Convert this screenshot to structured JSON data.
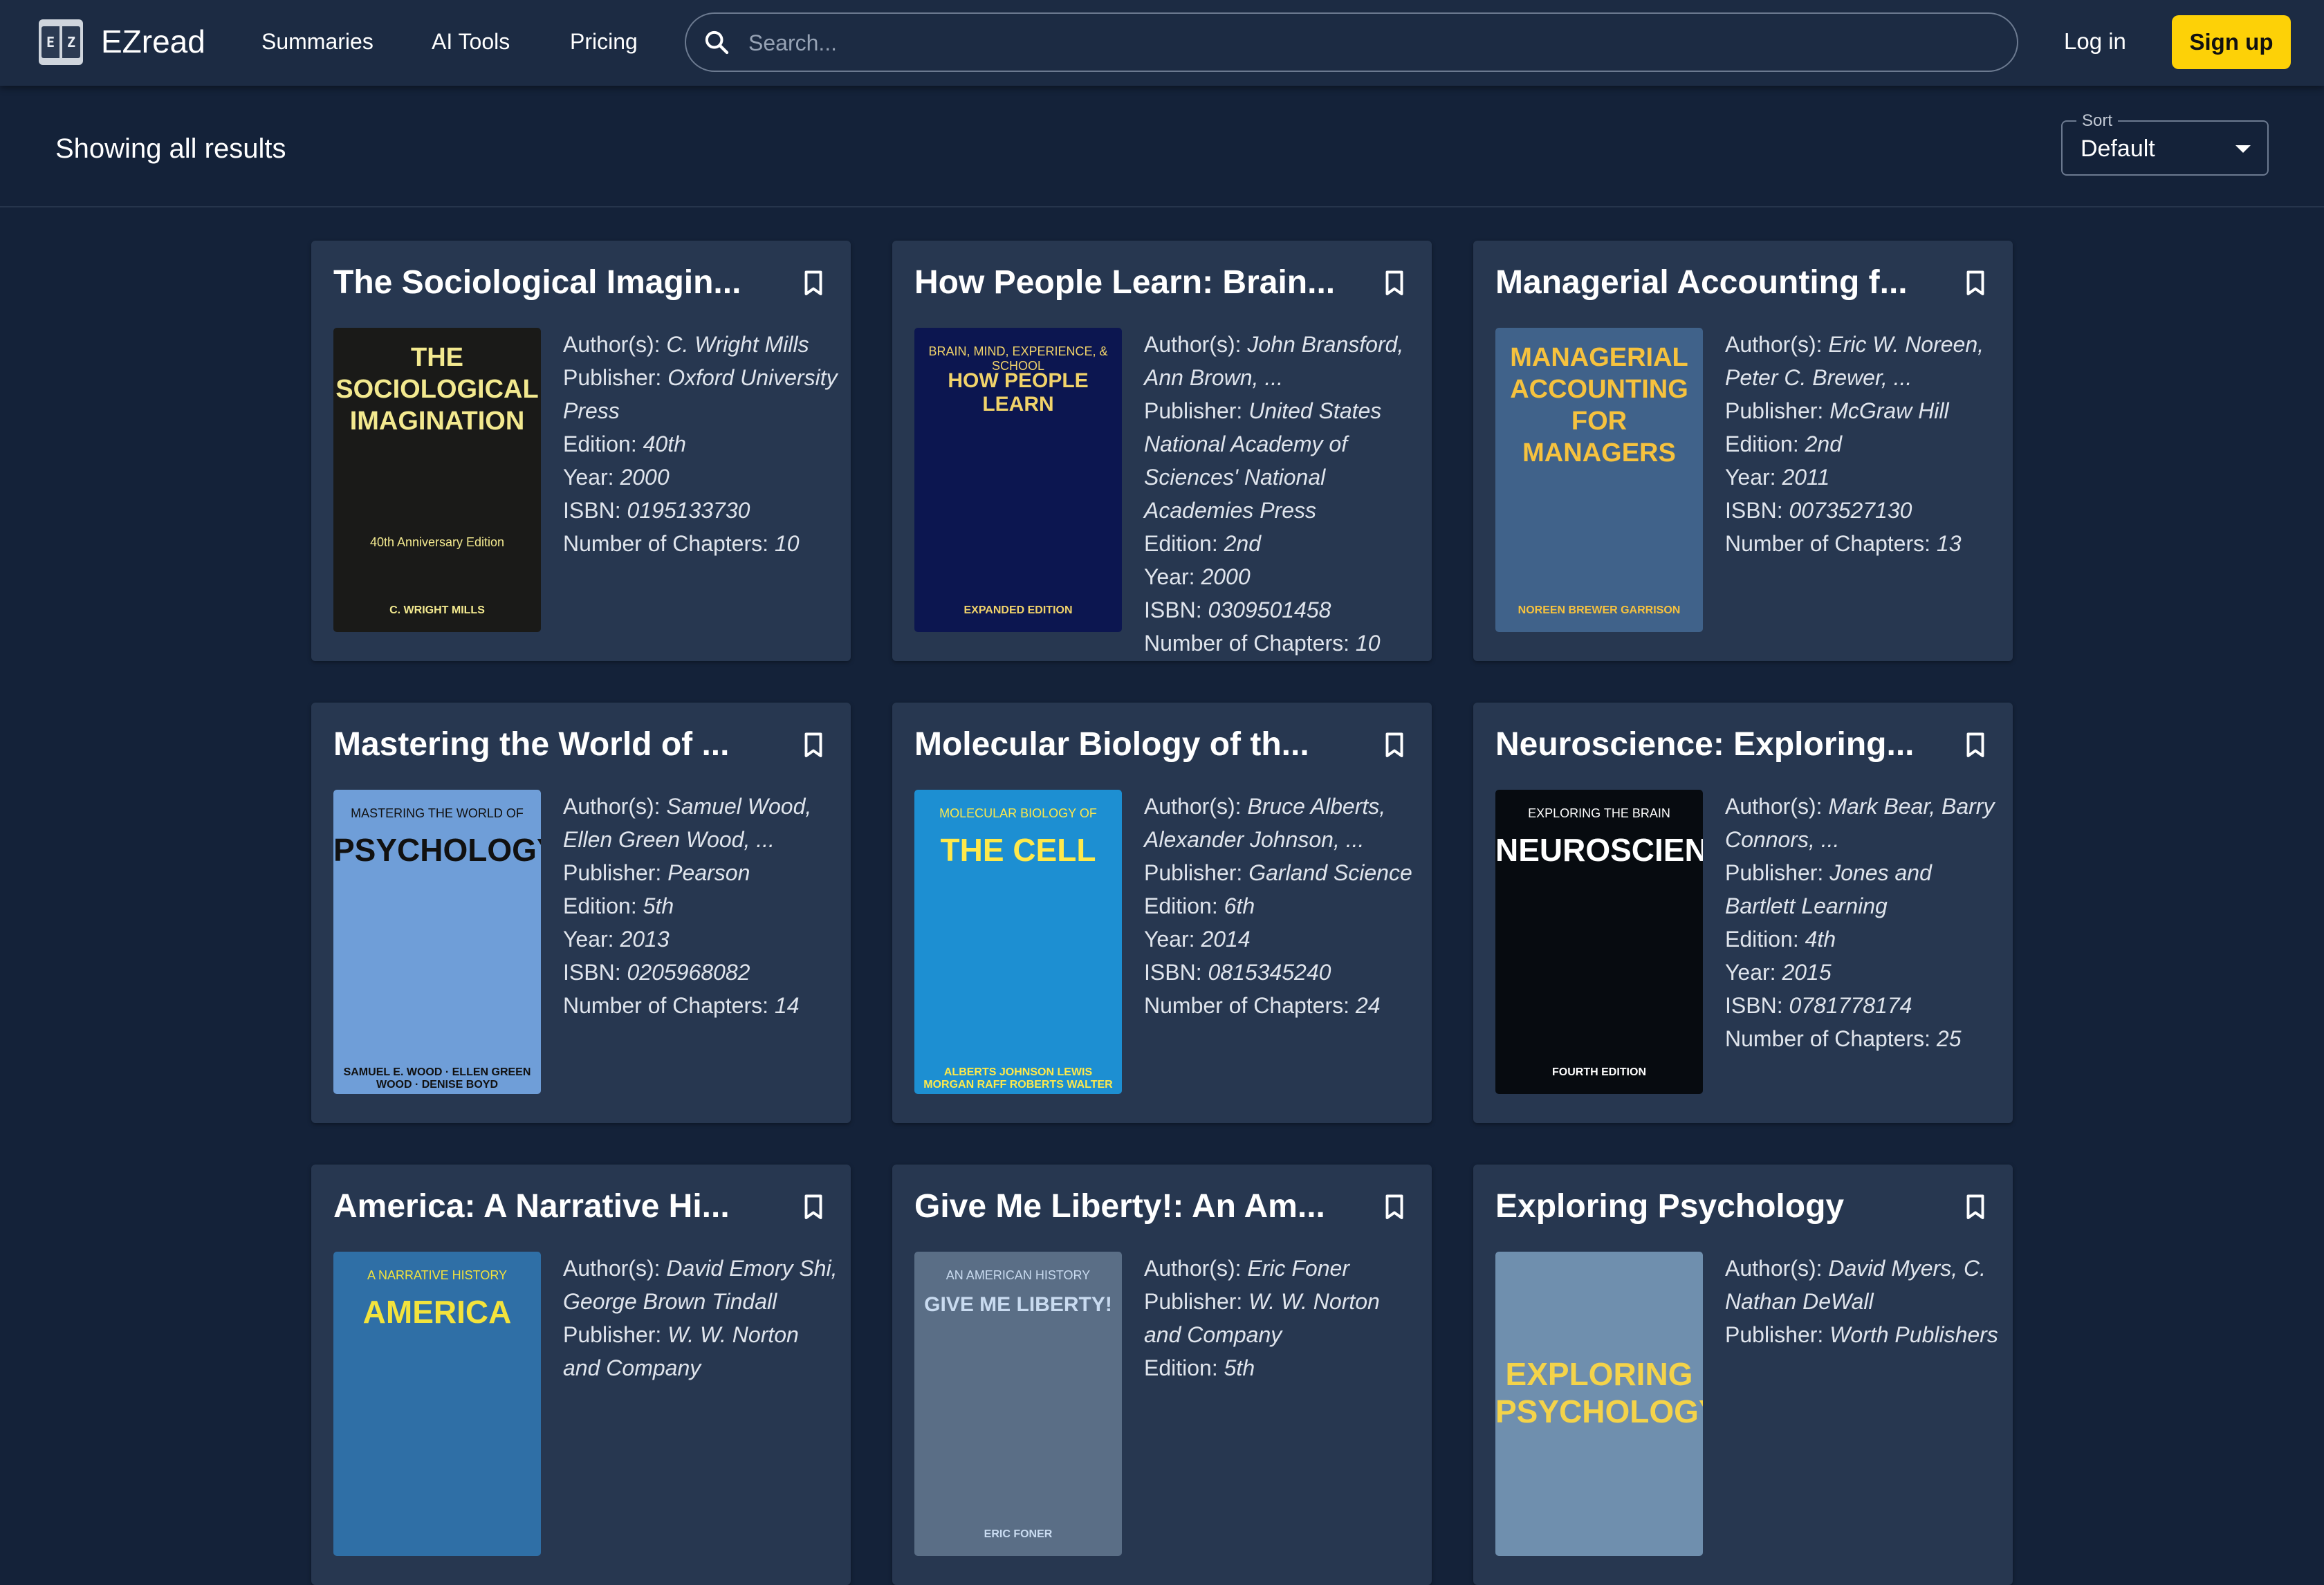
{
  "app": {
    "brand": "EZread",
    "logo_letters": [
      "E",
      "Z"
    ],
    "nav": [
      "Summaries",
      "AI Tools",
      "Pricing"
    ],
    "search_placeholder": "Search...",
    "login_label": "Log in",
    "signup_label": "Sign up"
  },
  "toolbar": {
    "results_text": "Showing all results",
    "sort_label": "Sort",
    "sort_value": "Default"
  },
  "labels": {
    "authors": "Author(s): ",
    "publisher": "Publisher: ",
    "edition": "Edition: ",
    "year": "Year: ",
    "isbn": "ISBN: ",
    "chapters": "Number of Chapters: "
  },
  "books": [
    {
      "title": "The Sociological Imagin...",
      "authors": "C. Wright Mills",
      "publisher": "Oxford University Press",
      "edition": "40th",
      "year": "2000",
      "isbn": "0195133730",
      "chapters": "10",
      "cover": {
        "bg": "#1a1a18",
        "lines": [
          "THE",
          "SOCIOLOGICAL",
          "IMAGINATION"
        ],
        "top": "40th Anniversary Edition",
        "bottom": "C. WRIGHT MILLS",
        "color": "#f3e98f"
      }
    },
    {
      "title": "How People Learn: Brain...",
      "authors": "John Bransford, Ann Brown, ...",
      "publisher": "United States National Academy of Sciences' National Academies Press",
      "edition": "2nd",
      "year": "2000",
      "isbn": "0309501458",
      "chapters": "10",
      "cover": {
        "bg": "#0c1650",
        "lines": [
          "HOW PEOPLE LEARN"
        ],
        "top": "BRAIN, MIND, EXPERIENCE, & SCHOOL",
        "bottom": "EXPANDED EDITION",
        "color": "#f1d36a"
      }
    },
    {
      "title": "Managerial Accounting f...",
      "authors": "Eric W. Noreen, Peter C. Brewer, ...",
      "publisher": "McGraw Hill",
      "edition": "2nd",
      "year": "2011",
      "isbn": "0073527130",
      "chapters": "13",
      "cover": {
        "bg": "#40628a",
        "lines": [
          "MANAGERIAL",
          "ACCOUNTING",
          "FOR",
          "MANAGERS"
        ],
        "top": "",
        "bottom": "NOREEN BREWER GARRISON",
        "color": "#f6c23e"
      }
    },
    {
      "title": "Mastering the World of ...",
      "authors": "Samuel Wood, Ellen Green Wood, ...",
      "publisher": "Pearson",
      "edition": "5th",
      "year": "2013",
      "isbn": "0205968082",
      "chapters": "14",
      "cover": {
        "bg": "#6f9ed8",
        "lines": [
          "PSYCHOLOGY"
        ],
        "top": "MASTERING THE WORLD OF",
        "bottom": "SAMUEL E. WOOD · ELLEN GREEN WOOD · DENISE BOYD",
        "color": "#111111"
      }
    },
    {
      "title": "Molecular Biology of th...",
      "authors": "Bruce Alberts, Alexander Johnson, ...",
      "publisher": "Garland Science",
      "edition": "6th",
      "year": "2014",
      "isbn": "0815345240",
      "chapters": "24",
      "cover": {
        "bg": "#1d8fd2",
        "lines": [
          "THE CELL"
        ],
        "top": "MOLECULAR BIOLOGY OF",
        "bottom": "ALBERTS JOHNSON LEWIS MORGAN RAFF ROBERTS WALTER",
        "color": "#ffe94a"
      }
    },
    {
      "title": "Neuroscience: Exploring...",
      "authors": "Mark Bear, Barry Connors, ...",
      "publisher": "Jones and Bartlett Learning",
      "edition": "4th",
      "year": "2015",
      "isbn": "0781778174",
      "chapters": "25",
      "cover": {
        "bg": "#070b10",
        "lines": [
          "NEUROSCIENCE"
        ],
        "top": "EXPLORING THE BRAIN",
        "bottom": "FOURTH EDITION",
        "color": "#ffffff"
      }
    },
    {
      "title": "America: A Narrative Hi...",
      "authors": "David Emory Shi, George Brown Tindall",
      "publisher": "W. W. Norton and Company",
      "edition": "",
      "year": "",
      "isbn": "",
      "chapters": "",
      "cover": {
        "bg": "#2f6fa6",
        "lines": [
          "AMERICA"
        ],
        "top": "A NARRATIVE HISTORY",
        "bottom": "",
        "color": "#f3e33c"
      }
    },
    {
      "title": "Give Me Liberty!: An Am...",
      "authors": "Eric Foner",
      "publisher": "W. W. Norton and Company",
      "edition": "5th",
      "year": "",
      "isbn": "",
      "chapters": "",
      "cover": {
        "bg": "#5a6e86",
        "lines": [
          "GIVE ME LIBERTY!"
        ],
        "top": "AN AMERICAN HISTORY",
        "bottom": "ERIC FONER",
        "color": "#c9dbf0"
      }
    },
    {
      "title": "Exploring Psychology",
      "authors": "David Myers, C. Nathan DeWall",
      "publisher": "Worth Publishers",
      "edition": "",
      "year": "",
      "isbn": "",
      "chapters": "",
      "cover": {
        "bg": "#6f8fae",
        "lines": [
          "EXPLORING",
          "PSYCHOLOGY"
        ],
        "top": "",
        "bottom": "",
        "color": "#f4d34a"
      }
    }
  ]
}
